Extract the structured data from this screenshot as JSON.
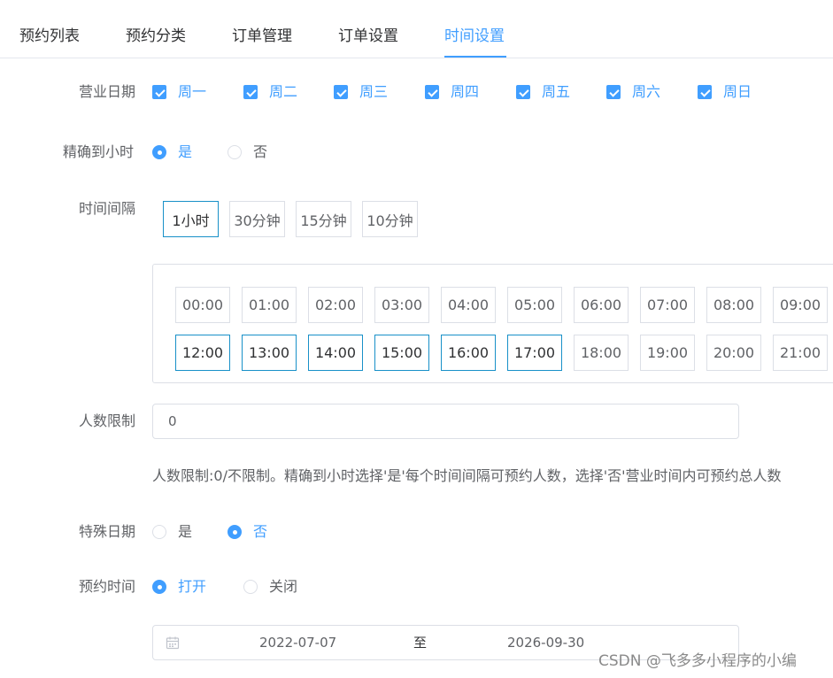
{
  "tabs": [
    {
      "label": "预约列表"
    },
    {
      "label": "预约分类"
    },
    {
      "label": "订单管理"
    },
    {
      "label": "订单设置"
    },
    {
      "label": "时间设置",
      "active": true
    }
  ],
  "business_days": {
    "label": "营业日期",
    "days": [
      {
        "label": "周一",
        "checked": true
      },
      {
        "label": "周二",
        "checked": true
      },
      {
        "label": "周三",
        "checked": true
      },
      {
        "label": "周四",
        "checked": true
      },
      {
        "label": "周五",
        "checked": true
      },
      {
        "label": "周六",
        "checked": true
      },
      {
        "label": "周日",
        "checked": true
      }
    ]
  },
  "exact_hour": {
    "label": "精确到小时",
    "options": [
      {
        "label": "是",
        "selected": true
      },
      {
        "label": "否",
        "selected": false
      }
    ]
  },
  "interval": {
    "label": "时间间隔",
    "options": [
      {
        "label": "1小时",
        "selected": true
      },
      {
        "label": "30分钟",
        "selected": false
      },
      {
        "label": "15分钟",
        "selected": false
      },
      {
        "label": "10分钟",
        "selected": false
      }
    ]
  },
  "time_slots": {
    "row1": [
      "00:00",
      "01:00",
      "02:00",
      "03:00",
      "04:00",
      "05:00",
      "06:00",
      "07:00",
      "08:00",
      "09:00"
    ],
    "row2": [
      "12:00",
      "13:00",
      "14:00",
      "15:00",
      "16:00",
      "17:00",
      "18:00",
      "19:00",
      "20:00",
      "21:00"
    ],
    "selected": [
      "12:00",
      "13:00",
      "14:00",
      "15:00",
      "16:00",
      "17:00"
    ]
  },
  "people_limit": {
    "label": "人数限制",
    "value": "0",
    "hint": "人数限制:0/不限制。精确到小时选择'是'每个时间间隔可预约人数，选择'否'营业时间内可预约总人数"
  },
  "special_date": {
    "label": "特殊日期",
    "options": [
      {
        "label": "是",
        "selected": false
      },
      {
        "label": "否",
        "selected": true
      }
    ]
  },
  "booking_time": {
    "label": "预约时间",
    "options": [
      {
        "label": "打开",
        "selected": true
      },
      {
        "label": "关闭",
        "selected": false
      }
    ]
  },
  "date_range": {
    "start": "2022-07-07",
    "separator": "至",
    "end": "2026-09-30"
  },
  "watermark": "CSDN @飞多多小程序的小编",
  "colors": {
    "accent": "#409eff",
    "border": "#dcdfe6",
    "selected_border": "#1890c8",
    "text": "#606266"
  }
}
